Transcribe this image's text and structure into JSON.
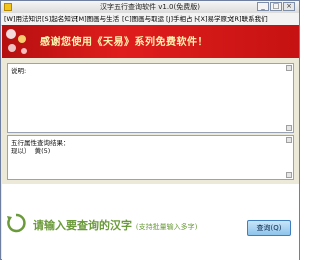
{
  "window": {
    "title": "汉字五行查询软件 v1.0(免费版)"
  },
  "titlebar": {
    "minimize": "_",
    "maximize": "□",
    "close": "×"
  },
  "menu": [
    "[W]用法知识",
    "[S]起名知识",
    "[M]图画与生活",
    "[C]图画与取运",
    "[J]手相占卜",
    "[X]易学原文",
    "[R]联系我们"
  ],
  "banner": {
    "text": "感谢您使用《天易》系列免费软件！"
  },
  "top_panel": {
    "text": "说明:"
  },
  "bottom_panel": {
    "line1": "五行属性查询结果：",
    "line2": "现以）  黄(5)"
  },
  "bottom": {
    "prompt": "请输入要查询的汉字",
    "hint": "(支持批量输入多字)",
    "query_button": "查询(Q)"
  },
  "colors": {
    "banner": "#c61212",
    "prompt": "#6b9a3a",
    "button": "#8ec4ec"
  }
}
